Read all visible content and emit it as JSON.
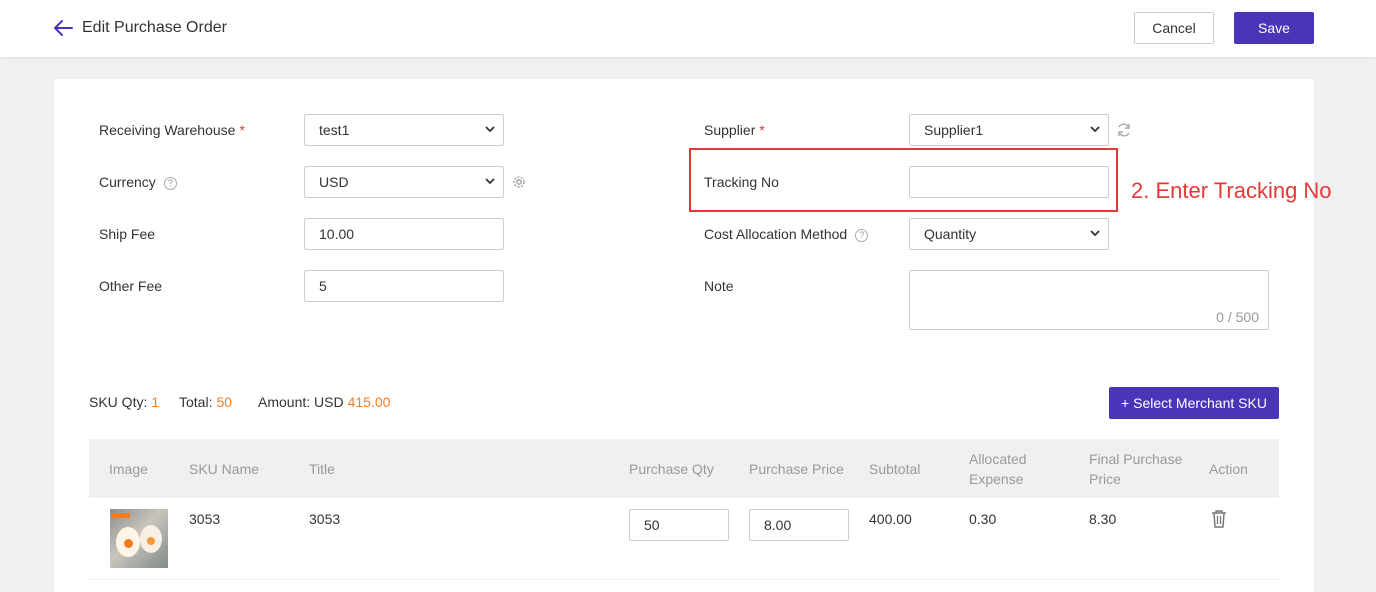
{
  "header": {
    "title": "Edit Purchase Order",
    "cancel_label": "Cancel",
    "save_label": "Save"
  },
  "form": {
    "receiving_warehouse": {
      "label": "Receiving Warehouse",
      "required_mark": "*",
      "value": "test1"
    },
    "currency": {
      "label": "Currency",
      "help": "?",
      "value": "USD"
    },
    "ship_fee": {
      "label": "Ship Fee",
      "value": "10.00"
    },
    "other_fee": {
      "label": "Other Fee",
      "value": "5"
    },
    "supplier": {
      "label": "Supplier",
      "required_mark": "*",
      "value": "Supplier1"
    },
    "tracking_no": {
      "label": "Tracking No",
      "value": ""
    },
    "cost_allocation": {
      "label": "Cost Allocation Method",
      "help": "?",
      "value": "Quantity"
    },
    "note": {
      "label": "Note",
      "value": "",
      "counter": "0 / 500"
    }
  },
  "annotation": {
    "text": "2. Enter Tracking No",
    "color": "#e53935"
  },
  "summary": {
    "sku_qty_label": "SKU Qty:",
    "sku_qty": "1",
    "total_label": "Total:",
    "total": "50",
    "amount_label": "Amount:",
    "amount_currency": "USD",
    "amount": "415.00"
  },
  "select_sku_button": "+ Select Merchant SKU",
  "table": {
    "headers": {
      "image": "Image",
      "sku_name": "SKU Name",
      "title": "Title",
      "purchase_qty": "Purchase Qty",
      "purchase_price": "Purchase Price",
      "subtotal": "Subtotal",
      "allocated_expense_1": "Allocated",
      "allocated_expense_2": "Expense",
      "final_price_1": "Final Purchase",
      "final_price_2": "Price",
      "action": "Action"
    },
    "rows": [
      {
        "sku_name": "3053",
        "title": "3053",
        "purchase_qty": "50",
        "purchase_price": "8.00",
        "subtotal": "400.00",
        "allocated_expense": "0.30",
        "final_price": "8.30"
      }
    ]
  },
  "colors": {
    "primary": "#4a35b8",
    "accent_orange": "#f47c20",
    "required_red": "#e53935"
  }
}
